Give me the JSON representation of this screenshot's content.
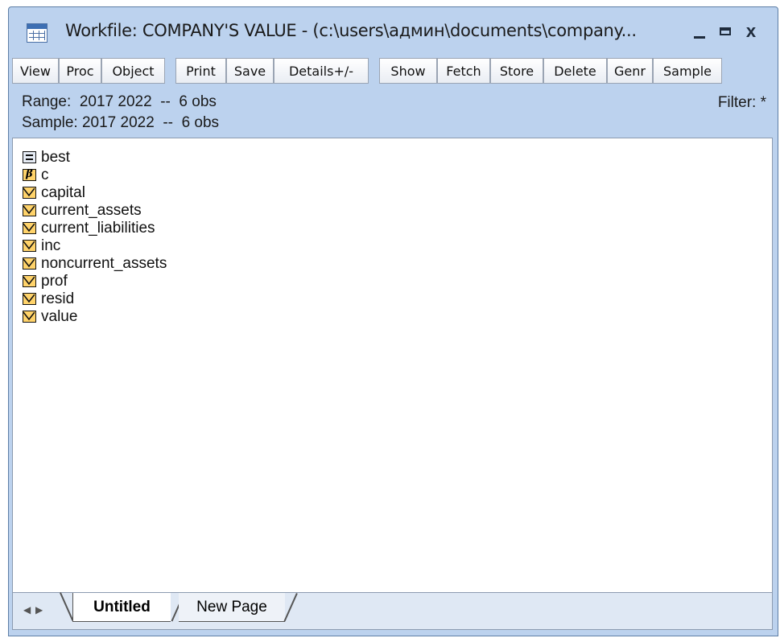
{
  "window": {
    "title": "Workfile: COMPANY'S VALUE - (c:\\users\\админ\\documents\\company...",
    "controls": {
      "minimize_icon": "minimize-icon",
      "maximize_icon": "maximize-icon",
      "close_label": "x"
    }
  },
  "toolbar": {
    "buttons": [
      "View",
      "Proc",
      "Object",
      "Print",
      "Save",
      "Details+/-",
      "Show",
      "Fetch",
      "Store",
      "Delete",
      "Genr",
      "Sample"
    ]
  },
  "info": {
    "range": "Range:  2017 2022  --  6 obs",
    "sample": "Sample: 2017 2022  --  6 obs",
    "filter": "Filter: *"
  },
  "objects": [
    {
      "name": "best",
      "icon": "equation-icon"
    },
    {
      "name": "c",
      "icon": "coefficient-icon",
      "glyph": "β"
    },
    {
      "name": "capital",
      "icon": "series-icon"
    },
    {
      "name": "current_assets",
      "icon": "series-icon"
    },
    {
      "name": "current_liabilities",
      "icon": "series-icon"
    },
    {
      "name": "inc",
      "icon": "series-icon"
    },
    {
      "name": "noncurrent_assets",
      "icon": "series-icon"
    },
    {
      "name": "prof",
      "icon": "series-icon"
    },
    {
      "name": "resid",
      "icon": "series-icon"
    },
    {
      "name": "value",
      "icon": "series-icon"
    }
  ],
  "tabs": {
    "active": "Untitled",
    "new": "New Page"
  },
  "colors": {
    "frame": "#bcd2ee",
    "series_icon": "#ffd36a",
    "tab_bar": "#dfe8f4"
  }
}
